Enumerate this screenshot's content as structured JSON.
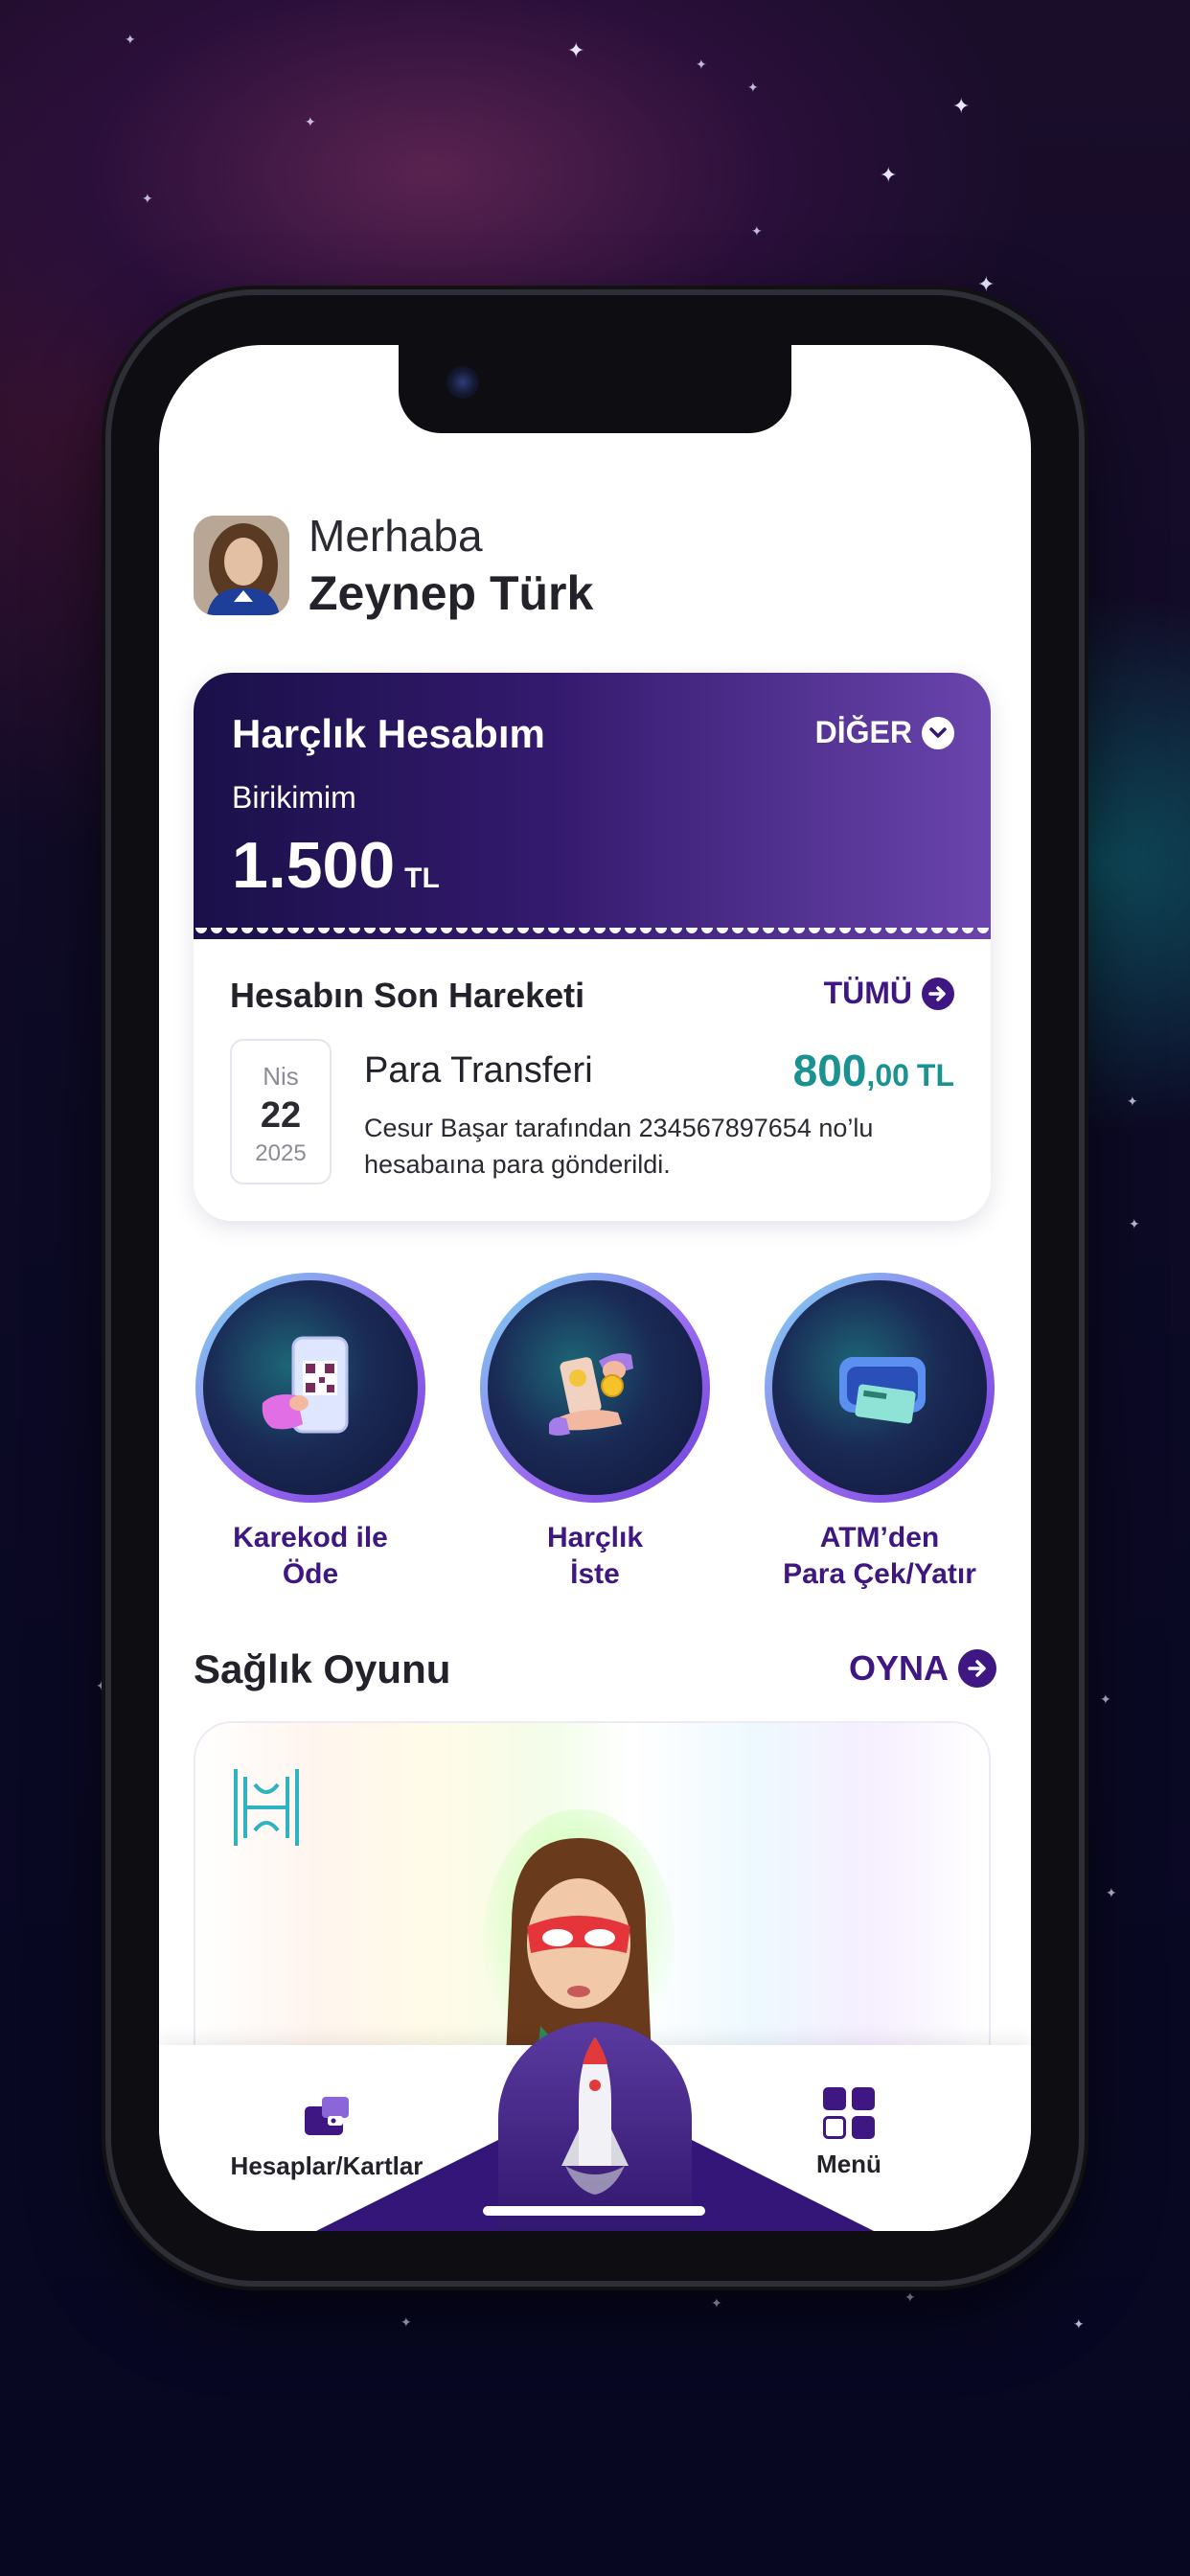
{
  "greeting": {
    "hello": "Merhaba",
    "name": "Zeynep Türk"
  },
  "account": {
    "title": "Harçlık Hesabım",
    "more_label": "DİĞER",
    "savings_label": "Birikimim",
    "savings_amount": "1.500",
    "savings_currency": "TL"
  },
  "movement": {
    "title": "Hesabın Son Hareketi",
    "all_label": "TÜMÜ",
    "date": {
      "month": "Nis",
      "day": "22",
      "year": "2025"
    },
    "tx_title": "Para Transferi",
    "amount_main": "800",
    "amount_decimal": ",00",
    "amount_currency": "TL",
    "description": "Cesur Başar tarafından 234567897654 no’lu hesabaına  para gönderildi."
  },
  "actions": [
    {
      "line1": "Karekod ile",
      "line2": "Öde",
      "icon": "qr-phone-icon"
    },
    {
      "line1": "Harçlık",
      "line2": "İste",
      "icon": "coin-exchange-icon"
    },
    {
      "line1": "ATM’den",
      "line2": "Para Çek/Yatır",
      "icon": "atm-card-icon"
    }
  ],
  "game": {
    "title": "Sağlık Oyunu",
    "play_label": "OYNA"
  },
  "nav": {
    "accounts_label": "Hesaplar/Kartlar",
    "menu_label": "Menü",
    "center_icon": "rocket-icon"
  },
  "colors": {
    "brand_purple": "#3e1782",
    "amount_teal": "#1a9292"
  }
}
